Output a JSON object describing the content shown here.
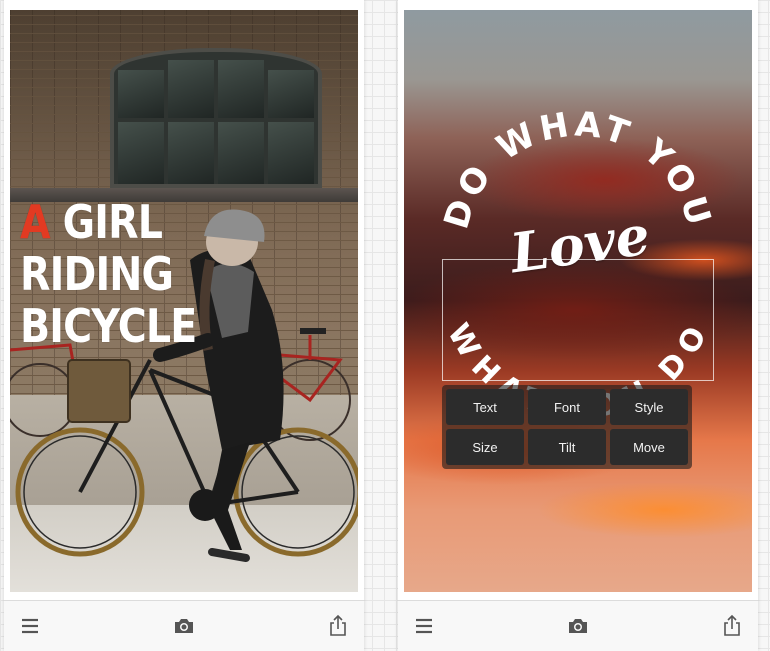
{
  "left_screen": {
    "headline": {
      "accent": "A",
      "line1_rest": " GIRL",
      "line2": "RIDING",
      "line3": "BICYCLE"
    },
    "toolbar": [
      "menu-icon",
      "camera-icon",
      "share-icon"
    ]
  },
  "right_screen": {
    "circle_top_text": "DO WHAT YOU",
    "center_text": "Love",
    "circle_bottom_text": "WHAT YOU DO",
    "edit_menu": [
      "Text",
      "Font",
      "Style",
      "Size",
      "Tilt",
      "Move"
    ],
    "toolbar": [
      "menu-icon",
      "camera-icon",
      "share-icon"
    ]
  },
  "colors": {
    "accent": "#e23a22",
    "text": "#ffffff",
    "toolbar_icon": "#555555"
  }
}
